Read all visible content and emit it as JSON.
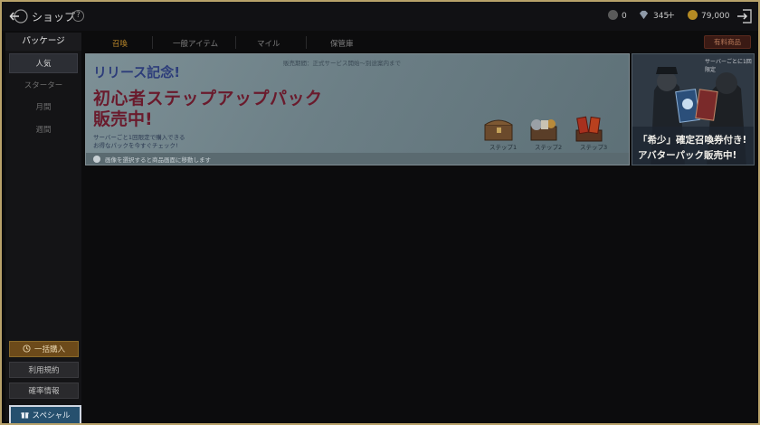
{
  "header": {
    "title": "ショップ",
    "help_glyph": "?",
    "currencies": [
      {
        "icon": "coin-gray-icon",
        "value": "0"
      },
      {
        "icon": "diamond-icon",
        "value": "345"
      },
      {
        "icon": "gold-coin-icon",
        "value": "79,000"
      }
    ],
    "plus": "+"
  },
  "sidebar": {
    "header": "パッケージ",
    "items": [
      {
        "label": "人気",
        "active": true
      },
      {
        "label": "スターター",
        "active": false
      },
      {
        "label": "月間",
        "active": false
      },
      {
        "label": "週間",
        "active": false
      }
    ],
    "buttons": {
      "bulk": "一括購入",
      "terms": "利用規約",
      "odds": "確率情報",
      "special": "スペシャル"
    }
  },
  "tabs": {
    "items": [
      "召喚",
      "一般アイテム",
      "マイル",
      "保管庫"
    ],
    "active_index": 0,
    "right_button": "有料商品"
  },
  "banner": {
    "sale_period": "販売期間：正式サービス開始〜別途案内まで",
    "subtitle": "リリース記念!",
    "title_line1": "初心者ステップアップパック",
    "title_line2": "販売中!",
    "desc_line1": "サーバーごと1回限定で購入できる",
    "desc_line2": "お得なパックを今すぐチェック!",
    "note": "画像を選択すると商品画面に移動します",
    "steps": [
      "ステップ1",
      "ステップ2",
      "ステップ3"
    ]
  },
  "side_banner": {
    "top": "サーバーごとに1回限定",
    "line1": "「希少」確定召喚券付き!",
    "line2": "アバターパック販売中!"
  },
  "colors": {
    "frame_border": "#b8a26a",
    "accent_gold": "#b8862a",
    "special_button": "#26506e"
  }
}
